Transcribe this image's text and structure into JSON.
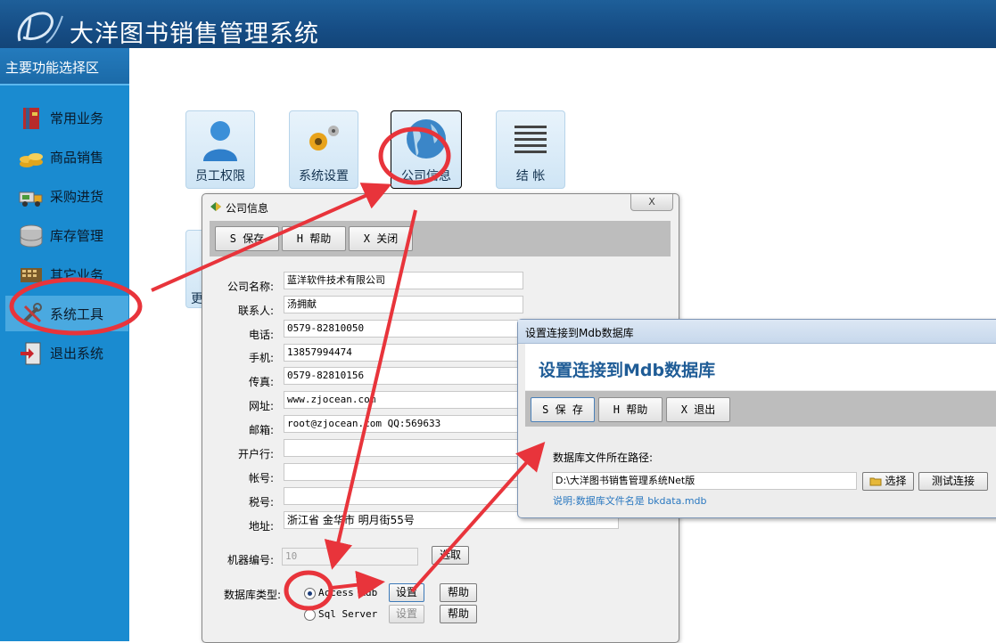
{
  "app": {
    "title": "大洋图书销售管理系统"
  },
  "sidebar": {
    "title": "主要功能选择区",
    "items": [
      {
        "label": "常用业务",
        "icon": "book-icon"
      },
      {
        "label": "商品销售",
        "icon": "coins-icon"
      },
      {
        "label": "采购进货",
        "icon": "truck-icon"
      },
      {
        "label": "库存管理",
        "icon": "database-icon"
      },
      {
        "label": "其它业务",
        "icon": "grid-icon"
      },
      {
        "label": "系统工具",
        "icon": "tools-icon"
      },
      {
        "label": "退出系统",
        "icon": "exit-icon"
      }
    ],
    "active_index": 5
  },
  "tiles": [
    {
      "label": "员工权限",
      "icon": "user-icon"
    },
    {
      "label": "系统设置",
      "icon": "gear-icon"
    },
    {
      "label": "公司信息",
      "icon": "globe-icon"
    },
    {
      "label": "结 帐",
      "icon": "ledger-icon"
    }
  ],
  "hidden_tile_fragment": "更",
  "company_dialog": {
    "title": "公司信息",
    "close_label": "X",
    "toolbar": {
      "save": "S 保存",
      "help": "H 帮助",
      "close": "X 关闭"
    },
    "fields": [
      {
        "label": "公司名称:",
        "value": "蓝洋软件技术有限公司"
      },
      {
        "label": "联系人:",
        "value": "汤拥献"
      },
      {
        "label": "电话:",
        "value": "0579-82810050"
      },
      {
        "label": "手机:",
        "value": "13857994474"
      },
      {
        "label": "传真:",
        "value": "0579-82810156"
      },
      {
        "label": "网址:",
        "value": "www.zjocean.com"
      },
      {
        "label": "邮箱:",
        "value": "root@zjocean.com  QQ:569633"
      },
      {
        "label": "开户行:",
        "value": ""
      },
      {
        "label": "帐号:",
        "value": ""
      },
      {
        "label": "税号:",
        "value": ""
      },
      {
        "label": "地址:",
        "value": "浙江省 金华市 明月街55号"
      }
    ],
    "machine_label": "机器编号:",
    "machine_value": "10",
    "pick_label": "选取",
    "db_type_label": "数据库类型:",
    "db_options": [
      {
        "label": "Access Mdb",
        "selected": true,
        "setup": "设置",
        "help": "帮助"
      },
      {
        "label": "Sql Server",
        "selected": false,
        "setup": "设置",
        "help": "帮助"
      }
    ]
  },
  "mdb_dialog": {
    "window_title": "设置连接到Mdb数据库",
    "heading": "设置连接到Mdb数据库",
    "toolbar": {
      "save": "S 保 存",
      "help": "H 帮助",
      "exit": "X 退出"
    },
    "path_label": "数据库文件所在路径:",
    "path_value": "D:\\大洋图书销售管理系统Net版",
    "select_label": "选择",
    "test_label": "测试连接",
    "note": "说明:数据库文件名是 bkdata.mdb"
  },
  "colors": {
    "header": "#1a5590",
    "sidebar": "#1a8bd0",
    "annotation": "#e8343b",
    "heading": "#1f5c96"
  }
}
